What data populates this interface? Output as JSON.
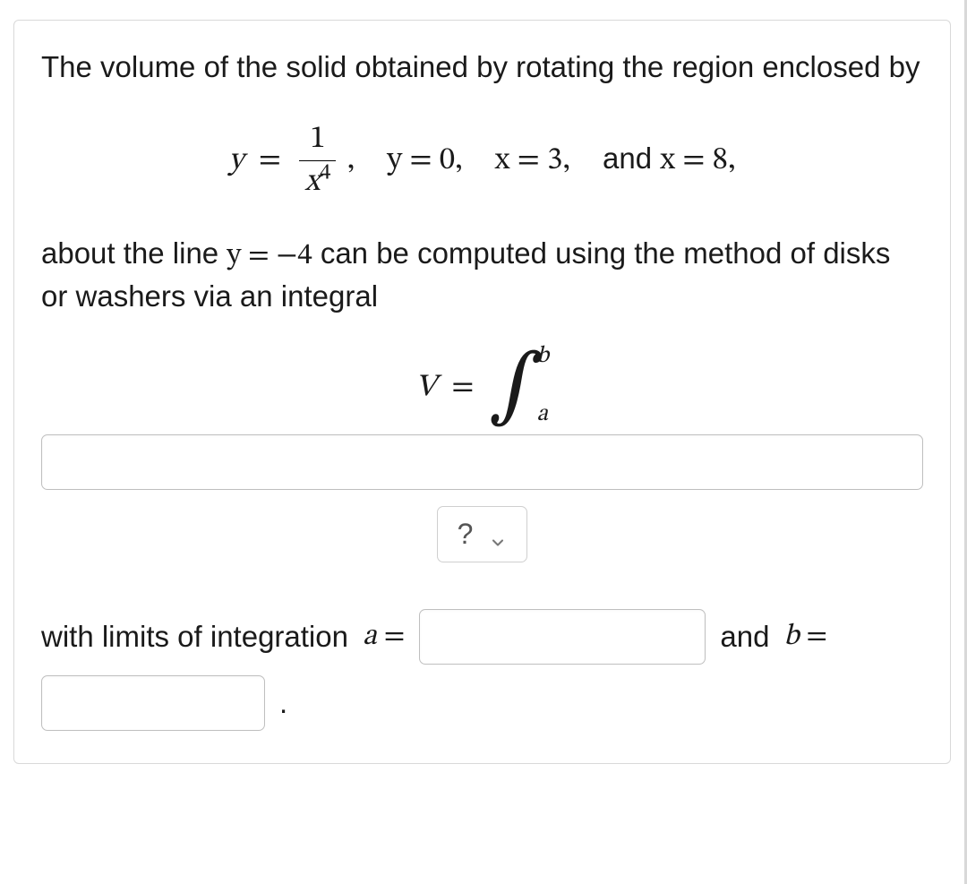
{
  "problem": {
    "intro_1": "The volume of the solid obtained by rotating the region enclosed by",
    "eq1_lhs": "y",
    "eq1_num": "1",
    "eq1_den_var": "x",
    "eq1_den_exp": "4",
    "eq2": "y = 0,",
    "eq3": "x = 3,",
    "eq4_prefix": "and ",
    "eq4": "x = 8,",
    "about_1": "about the line ",
    "about_eq": "y = −4",
    "about_2": " can be computed using the method of disks or washers via an integral",
    "vol_lhs": "V",
    "int_upper": "b",
    "int_lower": "a",
    "help_label": "?",
    "limits_prefix": "with limits of integration ",
    "a_var": "a",
    "eq_sign": "=",
    "and_text": " and ",
    "b_var": "b",
    "period": "."
  }
}
